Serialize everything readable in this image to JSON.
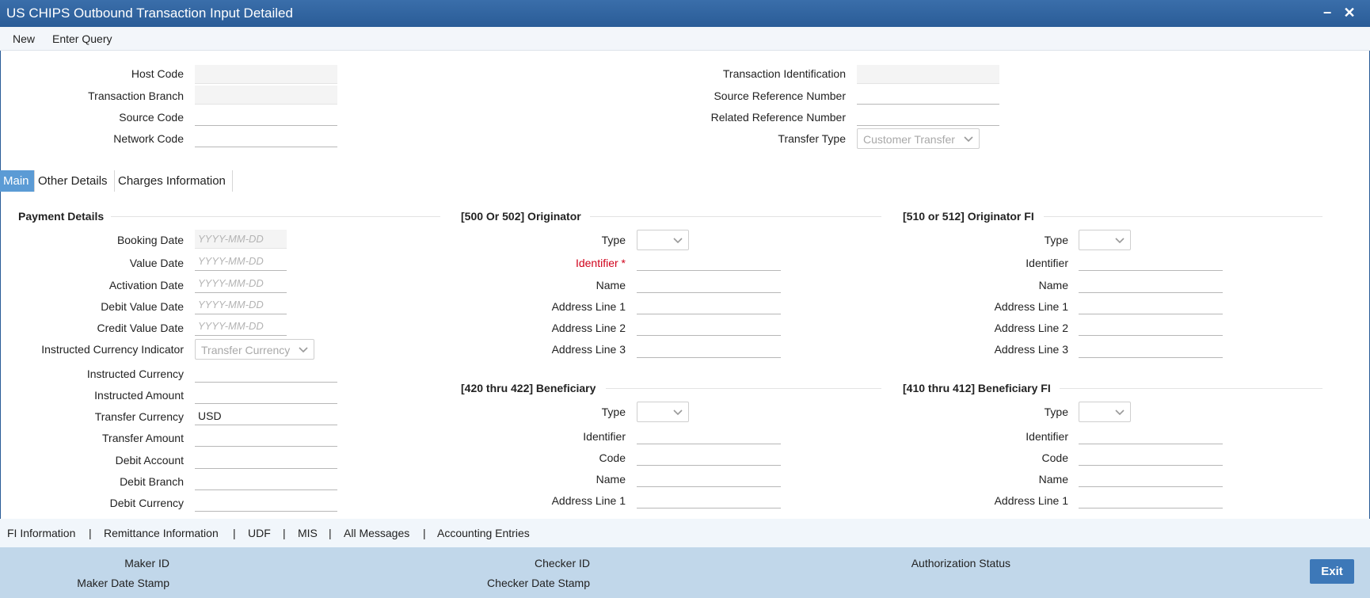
{
  "window": {
    "title": "US CHIPS Outbound Transaction Input Detailed",
    "minimize": "−",
    "close": "✕"
  },
  "menu": {
    "new": "New",
    "enter_query": "Enter Query"
  },
  "header_left": {
    "host_code": "Host Code",
    "transaction_branch": "Transaction Branch",
    "source_code": "Source Code",
    "network_code": "Network Code"
  },
  "header_right": {
    "transaction_identification": "Transaction Identification",
    "source_reference_number": "Source Reference Number",
    "related_reference_number": "Related Reference Number",
    "transfer_type": "Transfer Type",
    "transfer_type_value": "Customer Transfer"
  },
  "tabs": [
    "Main",
    "Other Details",
    "Charges Information"
  ],
  "payment": {
    "title": "Payment Details",
    "booking_date": "Booking Date",
    "value_date": "Value Date",
    "activation_date": "Activation Date",
    "debit_value_date": "Debit Value Date",
    "credit_value_date": "Credit Value Date",
    "date_placeholder": "YYYY-MM-DD",
    "instructed_currency_indicator": "Instructed Currency Indicator",
    "instructed_currency_indicator_value": "Transfer Currency",
    "instructed_currency": "Instructed Currency",
    "instructed_amount": "Instructed Amount",
    "transfer_currency": "Transfer Currency",
    "transfer_currency_value": "USD",
    "transfer_amount": "Transfer Amount",
    "debit_account": "Debit Account",
    "debit_branch": "Debit Branch",
    "debit_currency": "Debit Currency"
  },
  "originator": {
    "title": "[500 Or 502] Originator",
    "type": "Type",
    "identifier": "Identifier",
    "name": "Name",
    "address1": "Address Line 1",
    "address2": "Address Line 2",
    "address3": "Address Line 3"
  },
  "originator_fi": {
    "title": "[510 or 512] Originator FI",
    "type": "Type",
    "identifier": "Identifier",
    "name": "Name",
    "address1": "Address Line 1",
    "address2": "Address Line 2",
    "address3": "Address Line 3"
  },
  "beneficiary": {
    "title": "[420 thru 422] Beneficiary",
    "type": "Type",
    "identifier": "Identifier",
    "code": "Code",
    "name": "Name",
    "address1": "Address Line 1"
  },
  "beneficiary_fi": {
    "title": "[410 thru 412] Beneficiary FI",
    "type": "Type",
    "identifier": "Identifier",
    "code": "Code",
    "name": "Name",
    "address1": "Address Line 1"
  },
  "links": [
    "FI Information",
    "Remittance Information",
    "UDF",
    "MIS",
    "All Messages",
    "Accounting Entries"
  ],
  "link_separator": "|",
  "footer": {
    "maker_id": "Maker ID",
    "maker_date_stamp": "Maker Date Stamp",
    "checker_id": "Checker ID",
    "checker_date_stamp": "Checker Date Stamp",
    "authorization_status": "Authorization Status",
    "exit": "Exit"
  },
  "colors": {
    "titlebar": "#2a5c97",
    "tab_active": "#5b9bd5",
    "footer": "#c1d7ea",
    "required": "#d0021b",
    "exit_button": "#3d78b8"
  }
}
